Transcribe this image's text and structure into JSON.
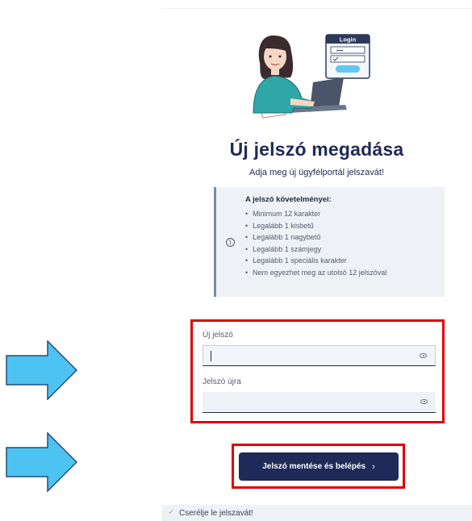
{
  "page": {
    "title": "Új jelszó megadása",
    "subtitle": "Adja meg új ügyfélportál jelszavát!"
  },
  "illustration": {
    "login_label": "Login",
    "password_dots": "••••"
  },
  "requirements": {
    "title": "A jelszó követelményei:",
    "items": [
      "Minimum 12 karakter",
      "Legalább 1 kisbetű",
      "Legalább 1 nagybetű",
      "Legalább 1 számjegy",
      "Legalább 1 speciális karakter",
      "Nem egyezhet meg az utolsó 12 jelszóval"
    ],
    "icon": "info-icon"
  },
  "form": {
    "new_password_label": "Új jelszó",
    "new_password_value": "",
    "repeat_password_label": "Jelszó újra",
    "repeat_password_value": "",
    "toggle_icon": "eye-icon"
  },
  "actions": {
    "save_label": "Jelszó mentése és belépés",
    "save_chevron": "›"
  },
  "footer": {
    "message": "Cserélje le jelszavát!",
    "icon": "check-icon"
  },
  "colors": {
    "brand": "#1f2a58",
    "highlight_frame": "#e00000",
    "arrow_fill": "#4cc3f0",
    "arrow_stroke": "#2b4a7a"
  }
}
